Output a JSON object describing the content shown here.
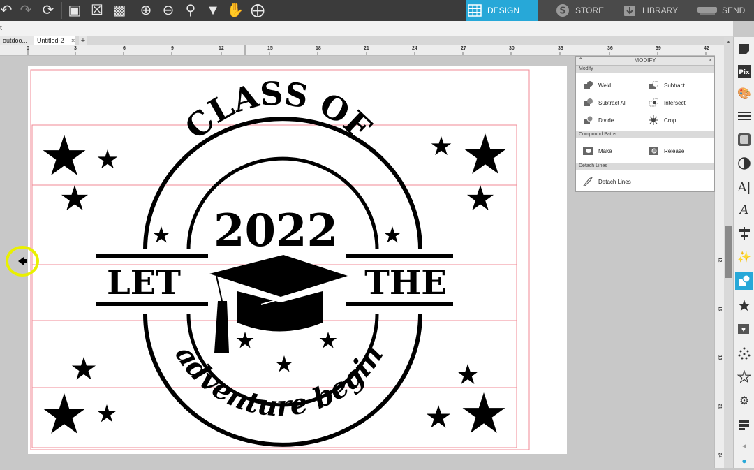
{
  "nav_tabs": [
    {
      "label": "DESIGN",
      "icon": "grid-icon"
    },
    {
      "label": "STORE",
      "icon": "silhouette-s-icon"
    },
    {
      "label": "LIBRARY",
      "icon": "library-download-icon"
    },
    {
      "label": "SEND",
      "icon": "cutter-icon"
    }
  ],
  "sub_toolbar": {
    "text": "t"
  },
  "doc_tabs": [
    "outdoo...",
    "Untitled-2"
  ],
  "ruler_top": [
    "0",
    "3",
    "6",
    "9",
    "12",
    "15",
    "18",
    "21",
    "24",
    "27",
    "30",
    "33",
    "36",
    "39",
    "42"
  ],
  "ruler_side": [
    "12",
    "15",
    "18",
    "21",
    "24"
  ],
  "modify_panel": {
    "title": "MODIFY",
    "sections": [
      {
        "name": "Modify",
        "items": [
          "Weld",
          "Subtract",
          "Subtract All",
          "Intersect",
          "Divide",
          "Crop"
        ]
      },
      {
        "name": "Compound Paths",
        "items": [
          "Make",
          "Release"
        ]
      },
      {
        "name": "Detach Lines",
        "items": [
          "Detach Lines"
        ]
      }
    ]
  },
  "design_text": {
    "class_of": "CLASS OF",
    "year": "2022",
    "let": "LET",
    "the": "THE",
    "script": "adventure begin"
  },
  "colors": {
    "accent": "#27a8d8",
    "highlight": "#e9f000",
    "cut_line": "#f08a96"
  }
}
